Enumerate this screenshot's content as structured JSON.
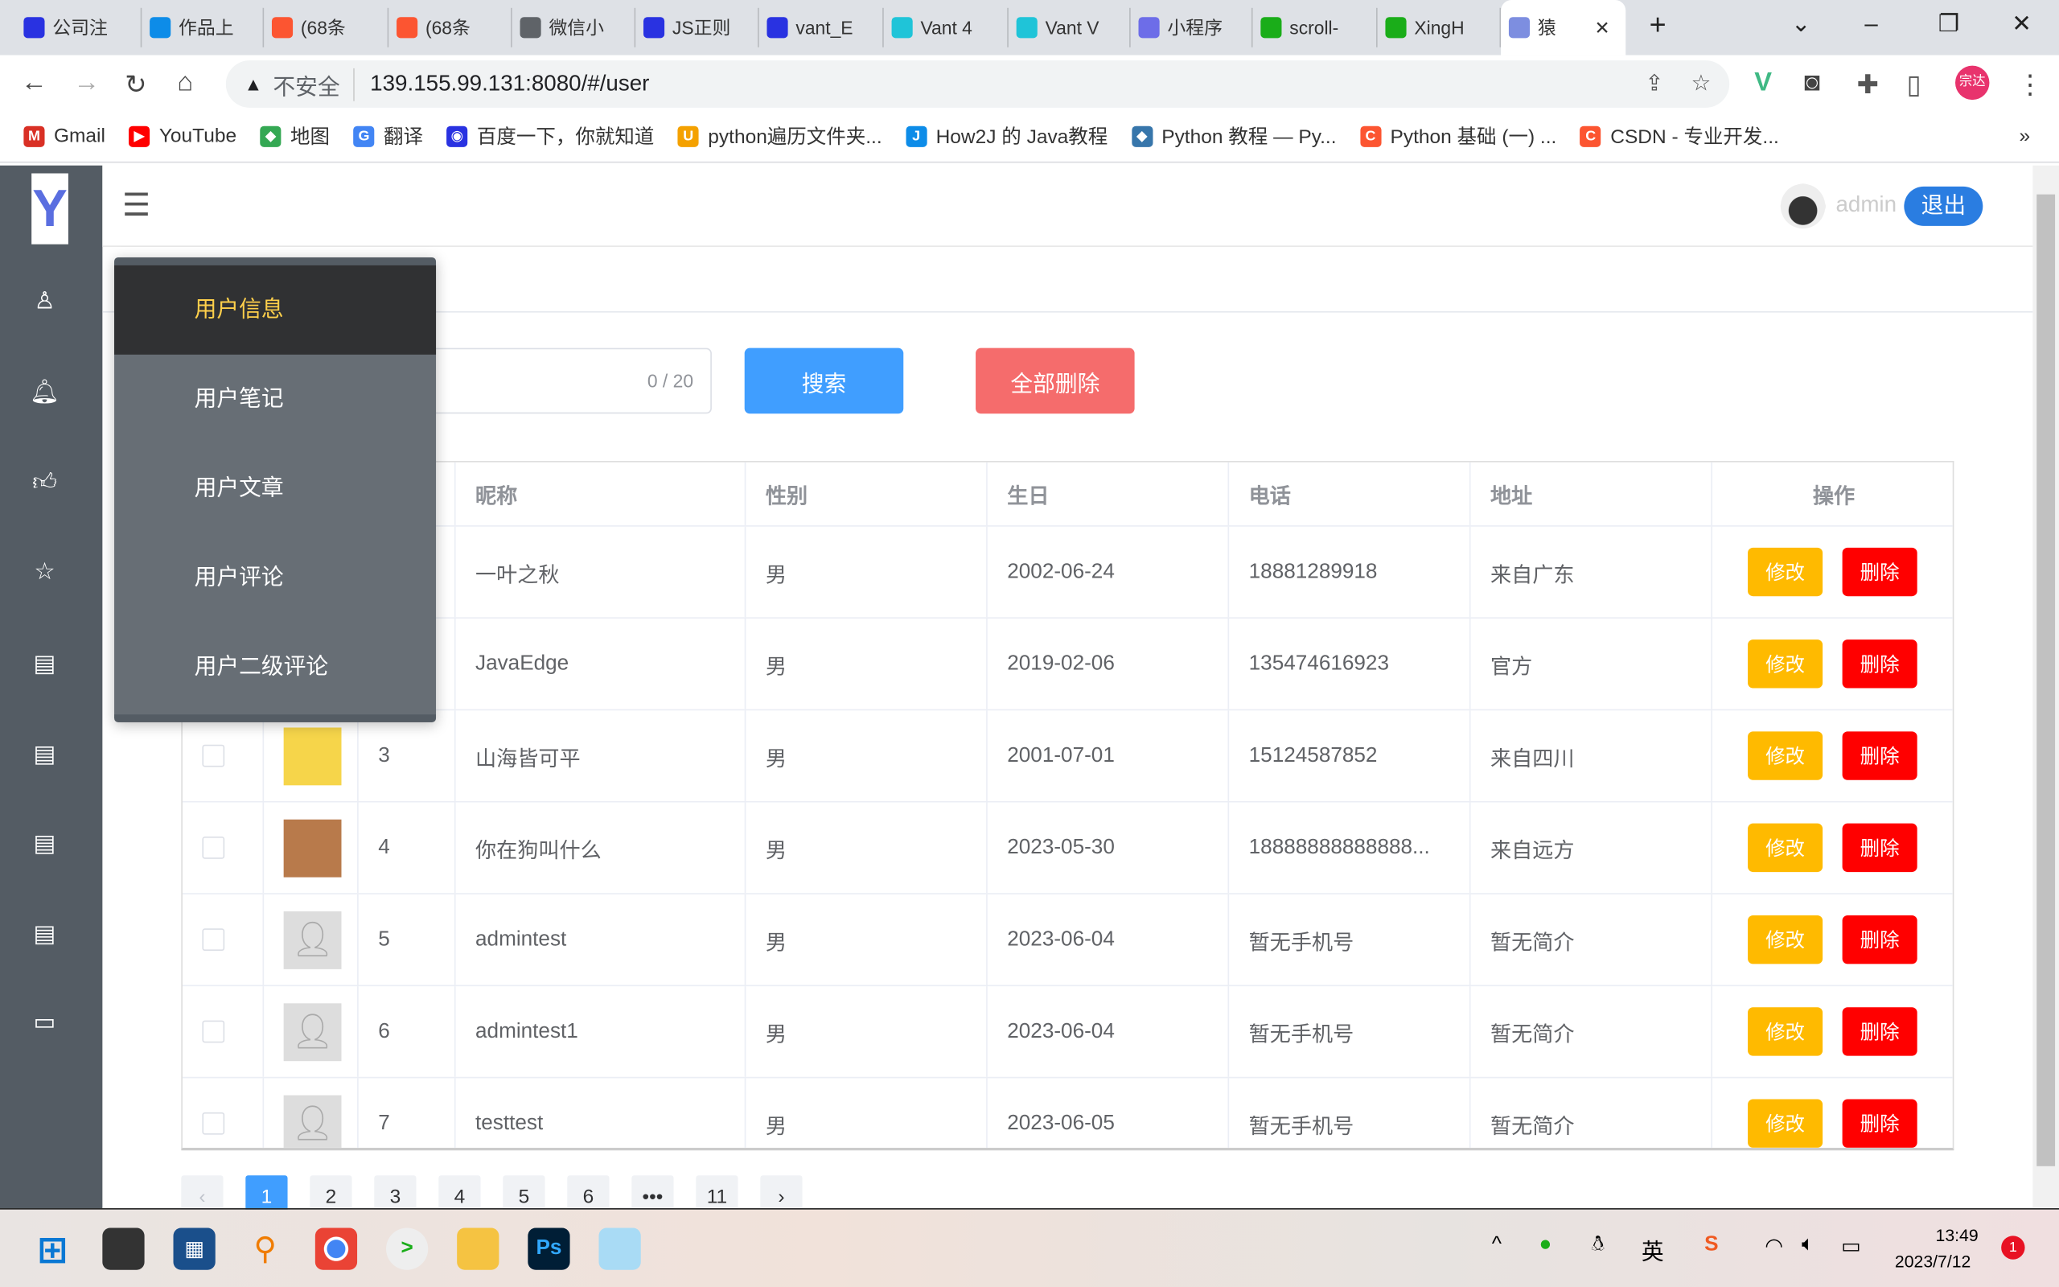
{
  "browser": {
    "tabs": [
      {
        "label": "公司注",
        "icon": "baidu-icon",
        "color": "#2932e1"
      },
      {
        "label": "作品上",
        "icon": "terminal-icon",
        "color": "#0d8ce8"
      },
      {
        "label": "(68条",
        "icon": "csdn-icon",
        "color": "#fc5531"
      },
      {
        "label": "(68条",
        "icon": "csdn-icon",
        "color": "#fc5531"
      },
      {
        "label": "微信小",
        "icon": "globe-icon",
        "color": "#5f6368"
      },
      {
        "label": "JS正则",
        "icon": "baidu-icon",
        "color": "#2932e1"
      },
      {
        "label": "vant_E",
        "icon": "baidu-icon",
        "color": "#2932e1"
      },
      {
        "label": "Vant 4",
        "icon": "vant-icon",
        "color": "#1fc4d8"
      },
      {
        "label": "Vant V",
        "icon": "vant-icon",
        "color": "#1fc4d8"
      },
      {
        "label": "小程序",
        "icon": "link-icon",
        "color": "#6d6de8"
      },
      {
        "label": "scroll-",
        "icon": "wechat-icon",
        "color": "#1aad19"
      },
      {
        "label": "XingH",
        "icon": "wechat-icon",
        "color": "#1aad19"
      },
      {
        "label": "猿",
        "icon": "y-logo-icon",
        "color": "#7d8ee0",
        "active": true
      }
    ],
    "security_label": "不安全",
    "url": "139.155.99.131:8080/#/user",
    "profile_label": "宗达",
    "bookmarks": [
      {
        "label": "Gmail",
        "color": "#d93025",
        "glyph": "M"
      },
      {
        "label": "YouTube",
        "color": "#ff0000",
        "glyph": "▶"
      },
      {
        "label": "地图",
        "color": "#34a853",
        "glyph": "◆"
      },
      {
        "label": "翻译",
        "color": "#4285f4",
        "glyph": "G"
      },
      {
        "label": "百度一下，你就知道",
        "color": "#2932e1",
        "glyph": "◉"
      },
      {
        "label": "python遍历文件夹...",
        "color": "#f4a100",
        "glyph": "U"
      },
      {
        "label": "How2J 的 Java教程",
        "color": "#0d8ce8",
        "glyph": "J"
      },
      {
        "label": "Python 教程 — Py...",
        "color": "#3776ab",
        "glyph": "◆"
      },
      {
        "label": "Python 基础 (一) ...",
        "color": "#fc5531",
        "glyph": "C"
      },
      {
        "label": "CSDN - 专业开发...",
        "color": "#fc5531",
        "glyph": "C"
      }
    ]
  },
  "header": {
    "username": "admin",
    "logout_label": "退出"
  },
  "logo_text": "Y",
  "menu": {
    "items": [
      "用户信息",
      "用户笔记",
      "用户文章",
      "用户评论",
      "用户二级评论"
    ],
    "active": 0
  },
  "toolbar": {
    "search_counter": "0 / 20",
    "search_label": "搜索",
    "delete_all_label": "全部删除"
  },
  "colors": {
    "primary": "#409eff",
    "danger_light": "#f56c6c",
    "warning": "#ffba00",
    "danger": "#ff0000",
    "sidebar": "#545c64",
    "menu_active_text": "#ffd04b"
  },
  "table": {
    "columns": [
      "昵称",
      "性别",
      "生日",
      "电话",
      "地址",
      "操作"
    ],
    "edit_label": "修改",
    "delete_label": "删除",
    "rows": [
      {
        "id": "",
        "nickname": "一叶之秋",
        "gender": "男",
        "birthday": "2002-06-24",
        "phone": "18881289918",
        "address": "来自广东",
        "avatar": "hidden"
      },
      {
        "id": "",
        "nickname": "JavaEdge",
        "gender": "男",
        "birthday": "2019-02-06",
        "phone": "135474616923",
        "address": "官方",
        "avatar": "hidden"
      },
      {
        "id": "3",
        "nickname": "山海皆可平",
        "gender": "男",
        "birthday": "2001-07-01",
        "phone": "15124587852",
        "address": "来自四川",
        "avatar": "pikachu"
      },
      {
        "id": "4",
        "nickname": "你在狗叫什么",
        "gender": "男",
        "birthday": "2023-05-30",
        "phone": "18888888888888...",
        "address": "来自远方",
        "avatar": "dog"
      },
      {
        "id": "5",
        "nickname": "admintest",
        "gender": "男",
        "birthday": "2023-06-04",
        "phone": "暂无手机号",
        "address": "暂无简介",
        "avatar": "default"
      },
      {
        "id": "6",
        "nickname": "admintest1",
        "gender": "男",
        "birthday": "2023-06-04",
        "phone": "暂无手机号",
        "address": "暂无简介",
        "avatar": "default"
      },
      {
        "id": "7",
        "nickname": "testtest",
        "gender": "男",
        "birthday": "2023-06-05",
        "phone": "暂无手机号",
        "address": "暂无简介",
        "avatar": "default"
      }
    ]
  },
  "pagination": {
    "pages": [
      "1",
      "2",
      "3",
      "4",
      "5",
      "6",
      "•••",
      "11"
    ],
    "current": "1",
    "prev": "‹",
    "next": "›"
  },
  "taskbar": {
    "time": "13:49",
    "date": "2023/7/12",
    "notifications": "1",
    "ime": "英"
  }
}
